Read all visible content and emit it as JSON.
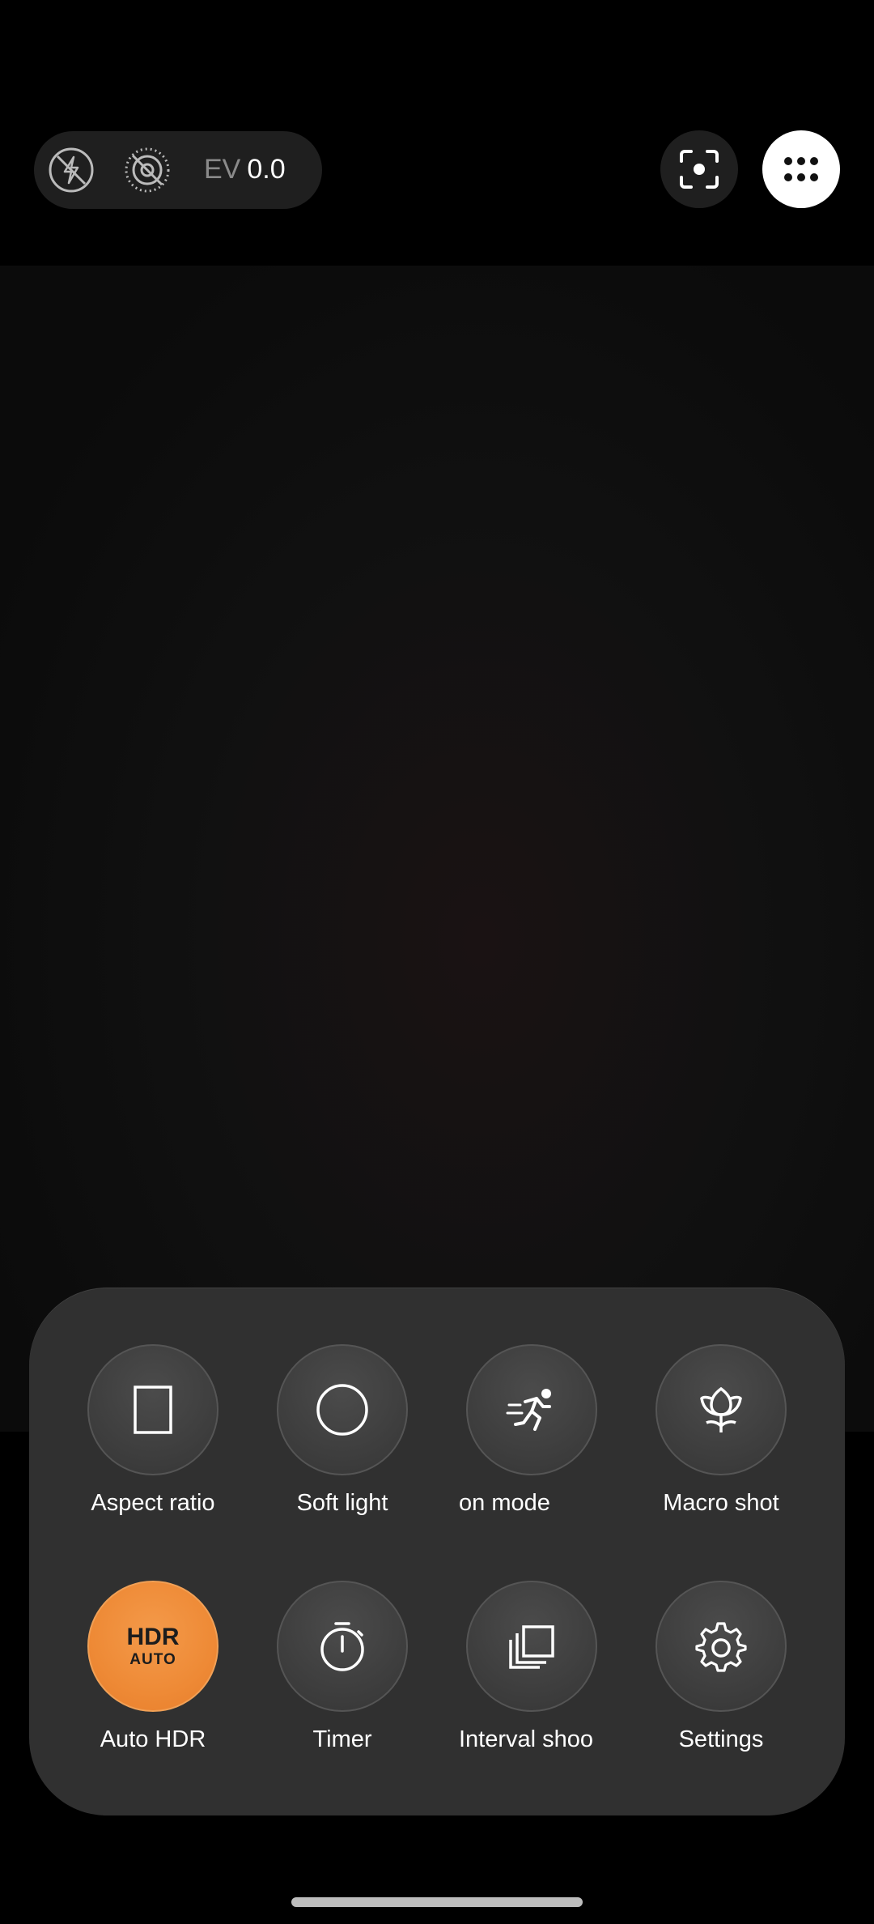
{
  "top_bar": {
    "ev_key": "EV",
    "ev_value": "0.0",
    "icons": [
      "flash-off-icon",
      "live-photo-off-icon",
      "focus-icon",
      "more-grid-icon"
    ]
  },
  "menu": {
    "items": [
      {
        "label": "Aspect ratio",
        "icon": "aspect-ratio-icon"
      },
      {
        "label": "Soft light",
        "icon": "soft-light-icon"
      },
      {
        "label": "on mode",
        "icon": "action-mode-icon"
      },
      {
        "label": "Macro shot",
        "icon": "macro-flower-icon"
      },
      {
        "label": "Auto HDR",
        "icon": "hdr-auto-icon",
        "active": true,
        "badge_top": "HDR",
        "badge_bottom": "AUTO"
      },
      {
        "label": "Timer",
        "icon": "timer-icon"
      },
      {
        "label": "Interval shoo",
        "icon": "interval-shoot-icon"
      },
      {
        "label": "Settings",
        "icon": "settings-gear-icon"
      }
    ]
  },
  "colors": {
    "accent": "#EE8A36",
    "sheet": "#303030",
    "background": "#000000"
  }
}
